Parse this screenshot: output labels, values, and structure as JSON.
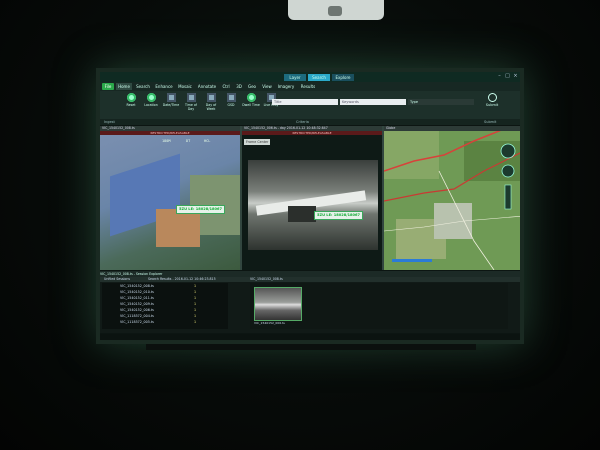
{
  "top_tabs": [
    "Layer",
    "Search",
    "Explore"
  ],
  "menu": [
    "File",
    "Home",
    "Search",
    "Enhance",
    "Mosaic",
    "Annotate",
    "Ctrl",
    "3D",
    "Geo",
    "View",
    "Imagery",
    "Results"
  ],
  "ribbon": {
    "buttons": [
      "Reset",
      "Location",
      "Date/Time",
      "Time of Day",
      "Day of Week",
      "GSD",
      "Dwell Time",
      "Live Only"
    ],
    "title_placeholder": "Title",
    "keywords_placeholder": "Keywords",
    "type_label": "Type",
    "submit_label": "Submit"
  },
  "groups": {
    "ingest": "Ingest",
    "criteria": "Criteria",
    "submit": "Submit"
  },
  "panels": {
    "left": {
      "header": "VIC_1540152_008.ts",
      "banner": "RESTRICTED/RELEASABLE",
      "tag": "5ZU LE: 18028/18067",
      "hud": [
        "180M",
        "DT",
        "HCL"
      ]
    },
    "center": {
      "header": "VIC_1540152_006.ts - day 2016-01-12 10:48:32.647",
      "banner": "RESTRICTED/RELEASABLE",
      "frame_label": "Frame Center",
      "tag": "5ZU LE: 18028/18067"
    },
    "right": {
      "header": "Globe"
    }
  },
  "explorer": {
    "tab_bar": "VIC_1540152_008.ts - Session Explorer",
    "tabs": [
      "Unfiled Sessions",
      "Search Results - 2016-01-12 10:46:23.815",
      "VIC_1540152_008.ts"
    ],
    "files": [
      {
        "name": "VIC_1540152_008.ts",
        "count": "1"
      },
      {
        "name": "VIC_1540152_010.ts",
        "count": "1"
      },
      {
        "name": "VIC_1540152_011.ts",
        "count": "1"
      },
      {
        "name": "VIC_1540152_009.ts",
        "count": "1"
      },
      {
        "name": "VIC_1540152_006.ts",
        "count": "1"
      },
      {
        "name": "VIC_1118572_004.ts",
        "count": "1"
      },
      {
        "name": "VIC_1118572_005.ts",
        "count": "1"
      }
    ],
    "thumb_label": "VIC_1540152_006.ts"
  },
  "colors": {
    "accent": "#2ba9c9",
    "file_button": "#2aa84a",
    "banner": "#5a1a1a"
  }
}
